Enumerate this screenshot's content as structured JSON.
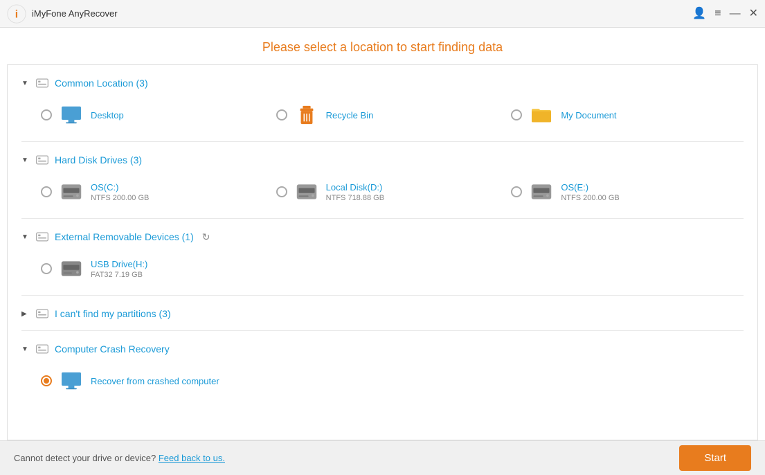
{
  "titleBar": {
    "appName": "iMyFone AnyRecover"
  },
  "header": {
    "title": "Please select a location to start finding data"
  },
  "sections": [
    {
      "id": "common-location",
      "title": "Common Location (3)",
      "expanded": true,
      "toggleIcon": "▼",
      "items": [
        {
          "id": "desktop",
          "name": "Desktop",
          "iconType": "desktop",
          "selected": false
        },
        {
          "id": "recycle-bin",
          "name": "Recycle Bin",
          "iconType": "recycle",
          "selected": false
        },
        {
          "id": "my-document",
          "name": "My Document",
          "iconType": "folder",
          "selected": false
        }
      ]
    },
    {
      "id": "hard-disk",
      "title": "Hard Disk Drives (3)",
      "expanded": true,
      "toggleIcon": "▼",
      "items": [
        {
          "id": "os-c",
          "name": "OS(C:)",
          "meta": "NTFS    200.00 GB",
          "iconType": "hdd",
          "selected": false
        },
        {
          "id": "local-d",
          "name": "Local Disk(D:)",
          "meta": "NTFS    718.88 GB",
          "iconType": "hdd",
          "selected": false
        },
        {
          "id": "os-e",
          "name": "OS(E:)",
          "meta": "NTFS    200.00 GB",
          "iconType": "hdd",
          "selected": false
        }
      ]
    },
    {
      "id": "external-removable",
      "title": "External Removable Devices (1)",
      "expanded": true,
      "toggleIcon": "▼",
      "hasRefresh": true,
      "items": [
        {
          "id": "usb-h",
          "name": "USB Drive(H:)",
          "meta": "FAT32    7.19 GB",
          "iconType": "usb",
          "selected": false
        }
      ]
    },
    {
      "id": "cant-find-partitions",
      "title": "I can't find my partitions (3)",
      "expanded": false,
      "toggleIcon": "▶",
      "items": []
    },
    {
      "id": "computer-crash-recovery",
      "title": "Computer Crash Recovery",
      "expanded": true,
      "toggleIcon": "▼",
      "items": [
        {
          "id": "recover-crashed",
          "name": "Recover from crashed computer",
          "iconType": "desktop",
          "selected": true
        }
      ]
    }
  ],
  "bottomBar": {
    "text": "Cannot detect your drive or device?",
    "linkText": "Feed back to us.",
    "startLabel": "Start"
  }
}
